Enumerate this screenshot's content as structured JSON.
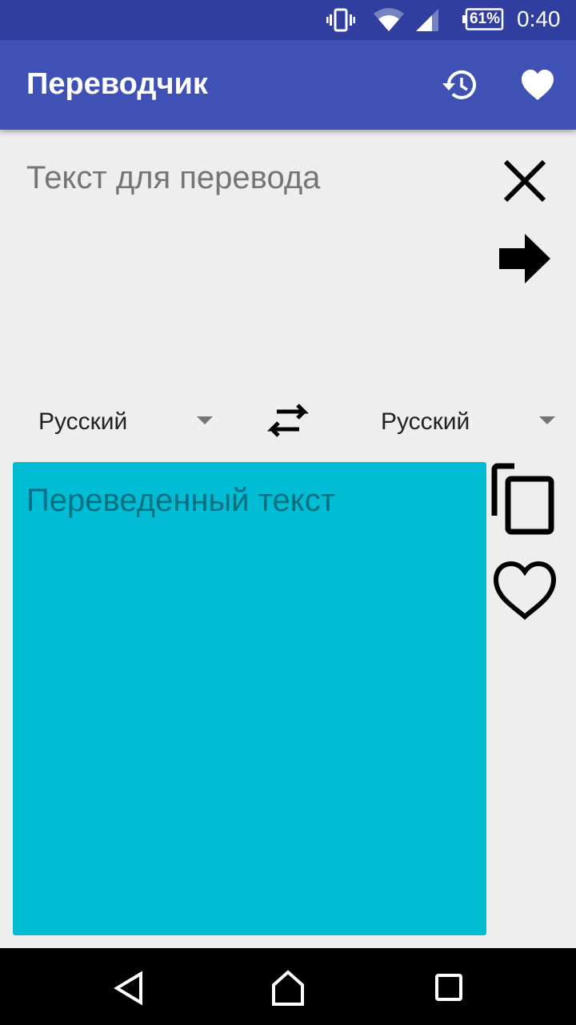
{
  "status_bar": {
    "icons": [
      "vibrate-icon",
      "wifi-icon",
      "signal-icon",
      "battery-icon"
    ],
    "battery": "61%",
    "time": "0:40"
  },
  "app_bar": {
    "title": "Переводчик",
    "actions": [
      "history-icon",
      "heart-filled-icon"
    ]
  },
  "input": {
    "placeholder": "Текст для перевода",
    "value": ""
  },
  "languages": {
    "source": "Русский",
    "target": "Русский"
  },
  "output": {
    "text": "Переведенный текст",
    "background": "#00bcd4"
  },
  "colors": {
    "status_bar": "#303f9f",
    "app_bar": "#3f51b5",
    "background": "#eeeeee"
  },
  "nav_bar": {
    "buttons": [
      "back-icon",
      "home-icon",
      "recents-icon"
    ]
  }
}
